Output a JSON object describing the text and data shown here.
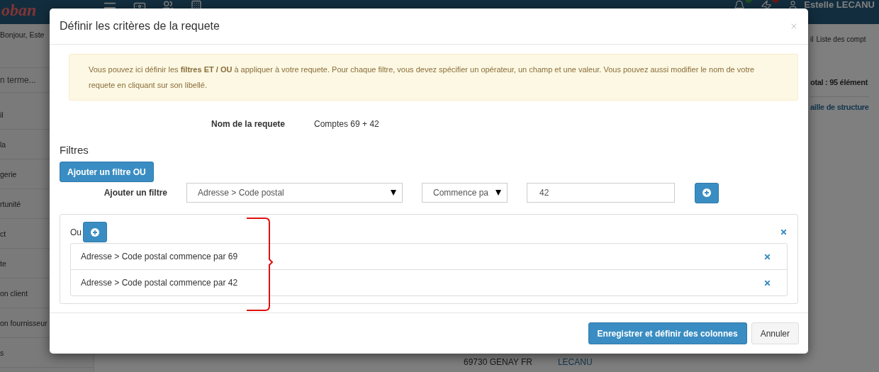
{
  "background": {
    "logo": "oban",
    "user": "Estelle LECANU",
    "greeting": "Bonjour, Este",
    "search": {
      "placeholder": "n terme..."
    },
    "sidebar": [
      "il",
      "la",
      "gerie",
      "rtunité",
      "ct",
      "te",
      "on client",
      "on fournisseur",
      "s"
    ],
    "breadcrumb": [
      "il",
      "Liste des compt"
    ],
    "total": "otal : 95 élément",
    "column_link": "aille de structure",
    "cells": [
      "69730 GENAY FR",
      "LECANU"
    ]
  },
  "dialog": {
    "title": "Définir les critères de la requete",
    "alert": "Vous pouvez ici définir les **filtres ET / OU** à appliquer à votre requete. Pour chaque filtre, vous devez spécifier un opérateur, un champ et une valeur. Vous pouvez aussi modifier le nom de votre requete en cliquant sur son libellé.",
    "name_label": "Nom de la requete",
    "name_value": "Comptes 69 + 42",
    "section_title": "Filtres",
    "add_or_button": "Ajouter un filtre OU",
    "add_filter": {
      "label": "Ajouter un filtre",
      "field": "Adresse > Code postal",
      "operator": "Commence pa",
      "value": "42"
    },
    "group": {
      "label": "Ou",
      "conditions": [
        {
          "text": "Adresse > Code postal commence par 69"
        },
        {
          "text": "Adresse > Code postal commence par 42"
        }
      ]
    },
    "buttons": [
      {
        "label": "Enregistrer et définir des colonnes",
        "kind": "primary"
      },
      {
        "label": "Annuler",
        "kind": "default"
      }
    ]
  }
}
